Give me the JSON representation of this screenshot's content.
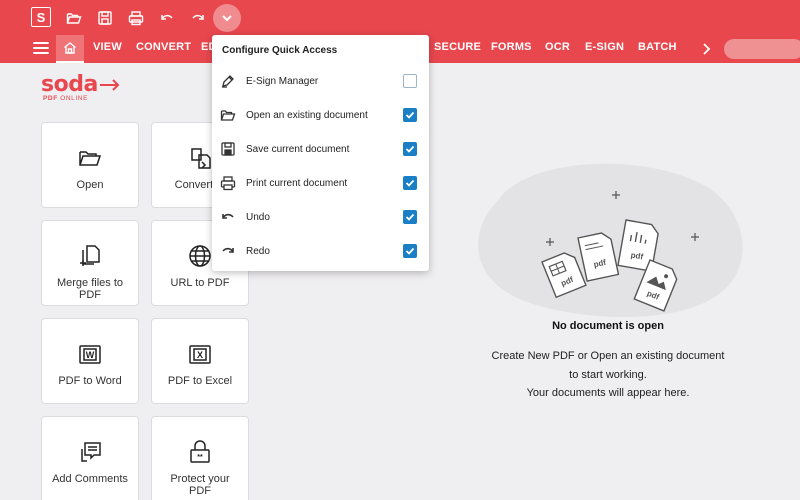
{
  "app": {
    "logo_letter": "S",
    "brand_name": "soda",
    "brand_sub_bold": "PDF",
    "brand_sub_rest": " ONLINE",
    "accent_color": "#e8474e"
  },
  "quick_access": {
    "icons": [
      "open-folder-icon",
      "save-icon",
      "print-icon",
      "undo-icon",
      "redo-icon",
      "chevron-down-icon"
    ]
  },
  "menu": {
    "tabs": [
      "VIEW",
      "CONVERT",
      "ED",
      "SECURE",
      "FORMS",
      "OCR",
      "E-SIGN",
      "BATCH"
    ]
  },
  "tiles": [
    {
      "label": "Open",
      "icon": "open-folder-icon"
    },
    {
      "label": "Convert to",
      "icon": "convert-icon"
    },
    {
      "label": "Merge files to PDF",
      "icon": "merge-files-icon"
    },
    {
      "label": "URL to PDF",
      "icon": "globe-icon"
    },
    {
      "label": "PDF to Word",
      "icon": "word-icon"
    },
    {
      "label": "PDF to Excel",
      "icon": "excel-icon"
    },
    {
      "label": "Add Comments",
      "icon": "comments-icon"
    },
    {
      "label": "Protect your PDF",
      "icon": "protect-icon"
    }
  ],
  "empty_state": {
    "title": "No document is open",
    "line1": "Create New PDF or Open an existing document",
    "line2": "to start working.",
    "line3": "Your documents will appear here.",
    "doc_labels": [
      "pdf",
      "pdf",
      "pdf",
      "pdf"
    ]
  },
  "dropdown": {
    "title": "Configure Quick Access",
    "items": [
      {
        "label": "E-Sign Manager",
        "icon": "pen-icon",
        "checked": false
      },
      {
        "label": "Open an existing document",
        "icon": "open-folder-icon",
        "checked": true
      },
      {
        "label": "Save current document",
        "icon": "save-icon",
        "checked": true
      },
      {
        "label": "Print current document",
        "icon": "print-icon",
        "checked": true
      },
      {
        "label": "Undo",
        "icon": "undo-icon",
        "checked": true
      },
      {
        "label": "Redo",
        "icon": "redo-icon",
        "checked": true
      }
    ]
  }
}
